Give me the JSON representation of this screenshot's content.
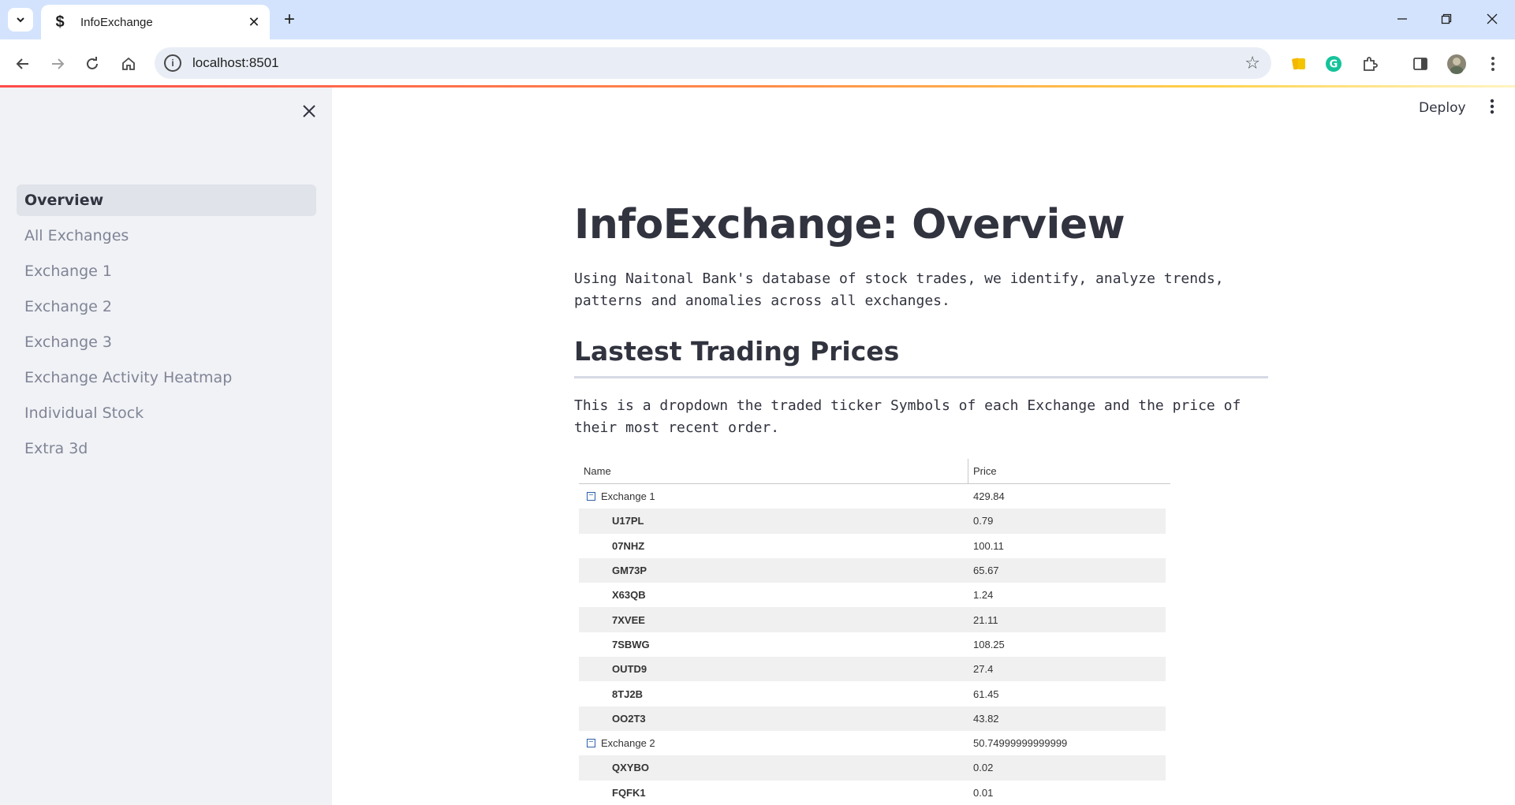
{
  "browser": {
    "tab_title": "InfoExchange",
    "url": "localhost:8501"
  },
  "header": {
    "deploy_label": "Deploy"
  },
  "sidebar": {
    "items": [
      {
        "label": "Overview",
        "active": true
      },
      {
        "label": "All Exchanges",
        "active": false
      },
      {
        "label": "Exchange 1",
        "active": false
      },
      {
        "label": "Exchange 2",
        "active": false
      },
      {
        "label": "Exchange 3",
        "active": false
      },
      {
        "label": "Exchange Activity Heatmap",
        "active": false
      },
      {
        "label": "Individual Stock",
        "active": false
      },
      {
        "label": "Extra 3d",
        "active": false
      }
    ]
  },
  "main": {
    "title": "InfoExchange: Overview",
    "intro": "Using Naitonal Bank's database of stock trades, we identify, analyze trends, patterns and anomalies across all exchanges.",
    "section_title": "Lastest Trading Prices",
    "section_desc": "This is a dropdown the traded ticker Symbols of each Exchange and the price of their most recent order."
  },
  "grid": {
    "headers": {
      "name": "Name",
      "price": "Price"
    },
    "rows": [
      {
        "type": "group",
        "name": "Exchange 1",
        "price": "429.84",
        "toggle": "−"
      },
      {
        "type": "child",
        "name": "U17PL",
        "price": "0.79"
      },
      {
        "type": "child",
        "name": "07NHZ",
        "price": "100.11"
      },
      {
        "type": "child",
        "name": "GM73P",
        "price": "65.67"
      },
      {
        "type": "child",
        "name": "X63QB",
        "price": "1.24"
      },
      {
        "type": "child",
        "name": "7XVEE",
        "price": "21.11"
      },
      {
        "type": "child",
        "name": "7SBWG",
        "price": "108.25"
      },
      {
        "type": "child",
        "name": "OUTD9",
        "price": "27.4"
      },
      {
        "type": "child",
        "name": "8TJ2B",
        "price": "61.45"
      },
      {
        "type": "child",
        "name": "OO2T3",
        "price": "43.82"
      },
      {
        "type": "group",
        "name": "Exchange 2",
        "price": "50.74999999999999",
        "toggle": "−"
      },
      {
        "type": "child",
        "name": "QXYBO",
        "price": "0.02"
      },
      {
        "type": "child",
        "name": "FQFK1",
        "price": "0.01"
      }
    ]
  },
  "colors": {
    "sidebar_bg": "#f0f2f6",
    "text": "#31333f",
    "muted_text": "#808495",
    "tabstrip_bg": "#d3e3fd"
  }
}
